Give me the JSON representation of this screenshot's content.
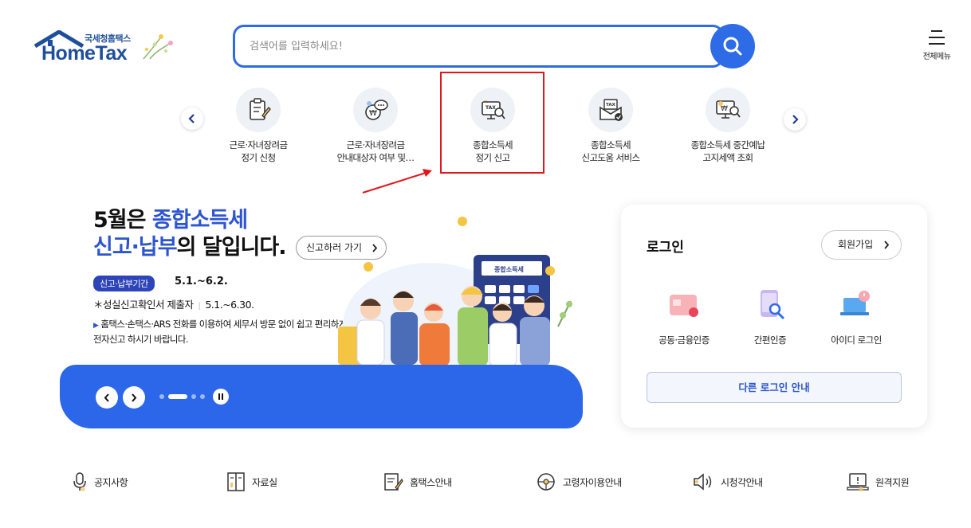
{
  "header": {
    "logo_sub": "국세청홈택스",
    "logo_main": "HomeTax",
    "search_placeholder": "검색어를 입력하세요!",
    "menu_label": "전체메뉴"
  },
  "quick_menu": [
    {
      "line1": "근로·자녀장려금",
      "line2": "정기 신청",
      "icon": "form-pen-icon"
    },
    {
      "line1": "근로·자녀장려금",
      "line2": "안내대상자 여부 및…",
      "icon": "chat-money-icon"
    },
    {
      "line1": "종합소득세",
      "line2": "정기 신고",
      "icon": "tax-monitor-search-icon"
    },
    {
      "line1": "종합소득세",
      "line2": "신고도움 서비스",
      "icon": "tax-mail-check-icon"
    },
    {
      "line1": "종합소득세 중간예납",
      "line2": "고지세액 조회",
      "icon": "monitor-search-icon"
    }
  ],
  "banner": {
    "title_line1_month": "5월은 ",
    "title_line1_blue": "종합소득세",
    "title_line2_blue": "신고·납부",
    "title_line2_rest": "의 달입니다.",
    "go_button": "신고하러 가기",
    "badge": "신고·납부기간",
    "period": "5.1.~6.2.",
    "line2_label": "＊성실신고확인서 제출자",
    "line2_period": "5.1.~6.30.",
    "line3": "홈택스·손택스·ARS 전화를 이용하여 세무서 방문 없이 쉽고 편리하게 전자신고 하시기 바랍니다.",
    "calc_label": "종합소득세"
  },
  "login": {
    "title": "로그인",
    "join": "회원가입",
    "options": [
      {
        "label": "공동·금융인증",
        "icon": "certificate-card-icon"
      },
      {
        "label": "간편인증",
        "icon": "phone-search-icon"
      },
      {
        "label": "아이디 로그인",
        "icon": "laptop-power-icon"
      }
    ],
    "other": "다른 로그인 안내"
  },
  "bottom_nav": [
    {
      "label": "공지사항",
      "icon": "microphone-icon"
    },
    {
      "label": "자료실",
      "icon": "bookshelf-icon"
    },
    {
      "label": "홈택스안내",
      "icon": "document-pen-icon"
    },
    {
      "label": "고령자이용안내",
      "icon": "car-wheel-icon"
    },
    {
      "label": "시청각안내",
      "icon": "speaker-icon"
    },
    {
      "label": "원격지원",
      "icon": "remote-monitor-icon"
    }
  ],
  "colors": {
    "brand_blue": "#2e6be6",
    "highlight_red": "#e3161c",
    "banner_blue": "#2b67e8"
  }
}
